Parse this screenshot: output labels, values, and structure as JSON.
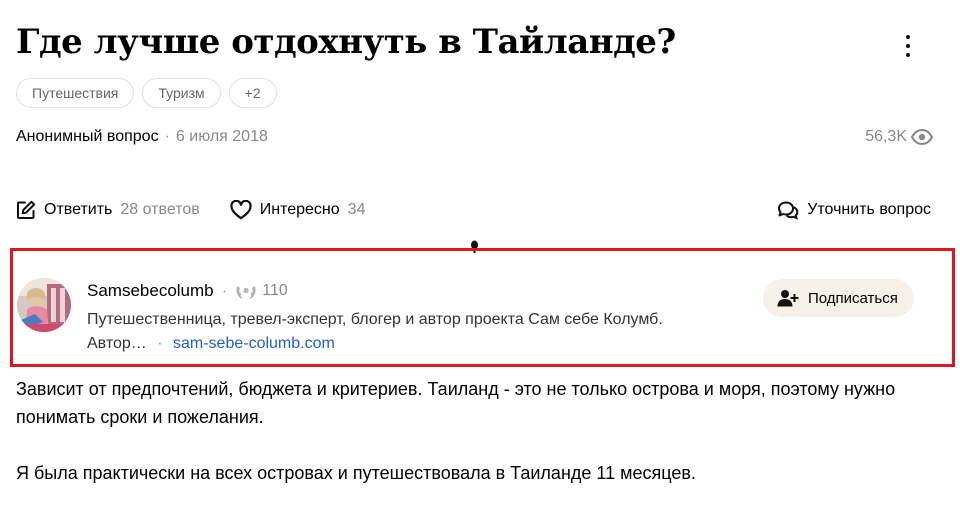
{
  "question": {
    "title": "Где лучше отдохнуть в Тайланде?",
    "tags": [
      "Путешествия",
      "Туризм",
      "+2"
    ],
    "author": "Анонимный вопрос",
    "date": "6 июля 2018",
    "views": "56,3K"
  },
  "actions": {
    "answer_label": "Ответить",
    "answer_count": "28 ответов",
    "interesting_label": "Интересно",
    "interesting_count": "34",
    "clarify_label": "Уточнить вопрос"
  },
  "answer_author": {
    "name": "Samsebecolumb",
    "separator": "·",
    "score": "110",
    "bio": "Путешественница, тревел-эксперт, блогер и автор проекта Сам себе Колумб.",
    "bio_more": "Автор…",
    "link_separator": "·",
    "link": "sam-sebe-columb.com",
    "subscribe_label": "Подписаться"
  },
  "answer": {
    "paragraphs": [
      "Зависит от предпочтений, бюджета и критериев. Таиланд - это не только острова и моря, поэтому нужно понимать сроки и пожелания.",
      "Я была практически на всех островах и путешествовала в Таиланде 11 месяцев."
    ]
  },
  "colors": {
    "highlight_border": "#e0151f",
    "link": "#1f5fd1",
    "subscribe_bg": "#f5f1e8",
    "muted": "#888888"
  },
  "icons": [
    "more-vertical-icon",
    "eye-icon",
    "edit-icon",
    "heart-icon",
    "chat-question-icon",
    "laurel-icon",
    "add-user-icon"
  ]
}
